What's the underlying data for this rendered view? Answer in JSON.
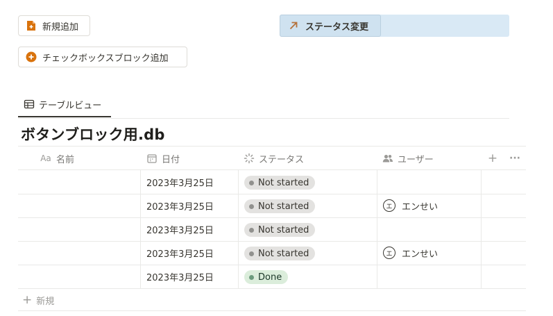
{
  "buttons": {
    "new_label": "新規追加",
    "status_label": "ステータス変更",
    "checkbox_label": "チェックボックスブロック追加"
  },
  "tabs": [
    {
      "label": "テーブルビュー"
    }
  ],
  "database": {
    "title": "ボタンブロック用.db",
    "columns": [
      {
        "label": "名前",
        "icon": "text-aa-icon"
      },
      {
        "label": "日付",
        "icon": "calendar-icon"
      },
      {
        "label": "ステータス",
        "icon": "status-spinner-icon"
      },
      {
        "label": "ユーザー",
        "icon": "people-icon"
      }
    ],
    "rows": [
      {
        "name": "",
        "date": "2023年3月25日",
        "status": "Not started",
        "user": ""
      },
      {
        "name": "",
        "date": "2023年3月25日",
        "status": "Not started",
        "user": "エンせい"
      },
      {
        "name": "",
        "date": "2023年3月25日",
        "status": "Not started",
        "user": ""
      },
      {
        "name": "",
        "date": "2023年3月25日",
        "status": "Not started",
        "user": "エンせい"
      },
      {
        "name": "",
        "date": "2023年3月25日",
        "status": "Done",
        "user": ""
      }
    ],
    "avatar_initial": "エ",
    "add_column_symbol": "+",
    "more_symbol": "···",
    "new_row_label": "新規",
    "new_row_symbol": "+"
  },
  "colors": {
    "not_started_bg": "#e3e2e0",
    "not_started_dot": "#91918e",
    "done_bg": "#dbeddb",
    "done_dot": "#6c9b7d",
    "status_button_bg": "#d9e9f5",
    "new_icon": "#d9730d",
    "checkbox_icon": "#d9730d"
  }
}
